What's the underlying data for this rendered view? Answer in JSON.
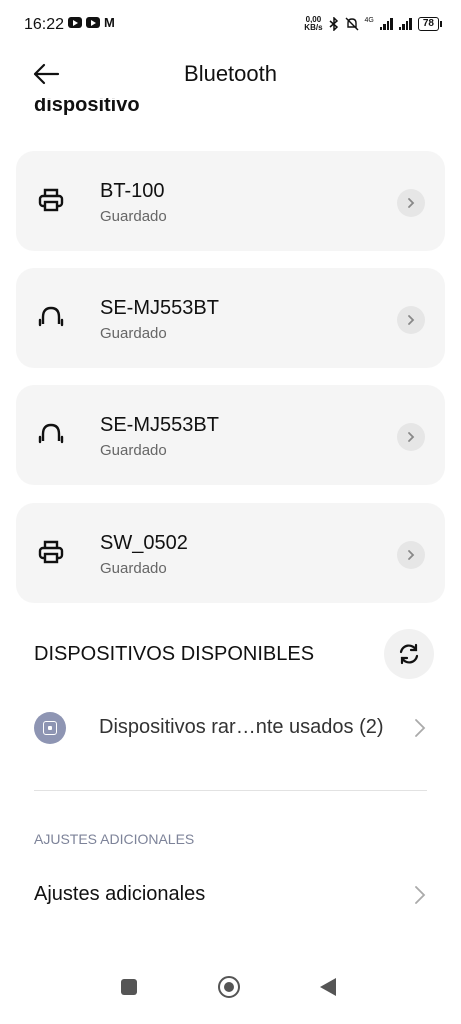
{
  "status_bar": {
    "time": "16:22",
    "speed_top": "0,00",
    "speed_bottom": "KB/s",
    "network": "4G",
    "battery": "78",
    "left_icons": [
      "youtube-icon",
      "youtube-icon",
      "gmail-icon"
    ],
    "right_icons": [
      "bluetooth-icon",
      "mute-icon",
      "signal-icon",
      "signal-icon",
      "battery-icon"
    ]
  },
  "header": {
    "title": "Bluetooth",
    "back_icon": "arrow-left-icon"
  },
  "partial_section_label": "dispositivo",
  "devices": [
    {
      "name": "BT-100",
      "status": "Guardado",
      "icon": "printer-icon"
    },
    {
      "name": "SE-MJ553BT",
      "status": "Guardado",
      "icon": "headphones-icon"
    },
    {
      "name": "SE-MJ553BT",
      "status": "Guardado",
      "icon": "headphones-icon"
    },
    {
      "name": "SW_0502",
      "status": "Guardado",
      "icon": "printer-icon"
    }
  ],
  "available": {
    "title": "DISPOSITIVOS DISPONIBLES",
    "refresh_icon": "refresh-icon",
    "rarely_used": "Dispositivos rar…nte usados (2)"
  },
  "additional": {
    "section_title": "AJUSTES ADICIONALES",
    "item_label": "Ajustes adicionales"
  },
  "colors": {
    "card_bg": "#f5f5f5",
    "chevron_bg": "#e6e6e6",
    "device_icon_bg": "#8e95b3",
    "secondary_text": "#666666"
  }
}
